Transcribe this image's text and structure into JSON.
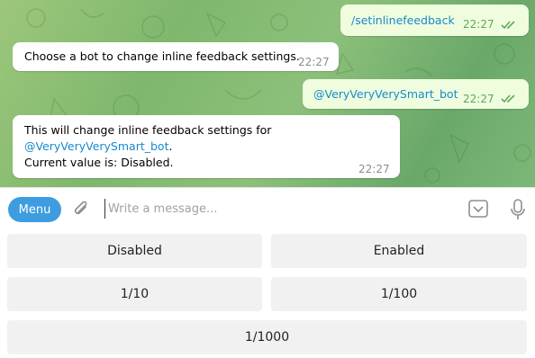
{
  "messages": {
    "m1": {
      "text": "/setinlinefeedback",
      "time": "22:27"
    },
    "m2": {
      "text": "Choose a bot to change inline feedback settings.",
      "time": "22:27"
    },
    "m3": {
      "text": "@VeryVeryVerySmart_bot",
      "time": "22:27"
    },
    "m4": {
      "line1": "This will change inline feedback settings for",
      "mention": "@VeryVeryVerySmart_bot",
      "period": ".",
      "line3": "Current value is: Disabled.",
      "time": "22:27"
    }
  },
  "composer": {
    "menu_label": "Menu",
    "placeholder": "Write a message..."
  },
  "keyboard": {
    "b1": "Disabled",
    "b2": "Enabled",
    "b3": "1/10",
    "b4": "1/100",
    "b5": "1/1000"
  },
  "icons": {
    "attach": "paperclip-icon",
    "emoji": "bot-keyboard-icon",
    "mic": "microphone-icon",
    "read": "double-check-icon"
  },
  "colors": {
    "accent": "#3e9de0",
    "link": "#168acd",
    "outgoing_bubble": "#effdde"
  }
}
